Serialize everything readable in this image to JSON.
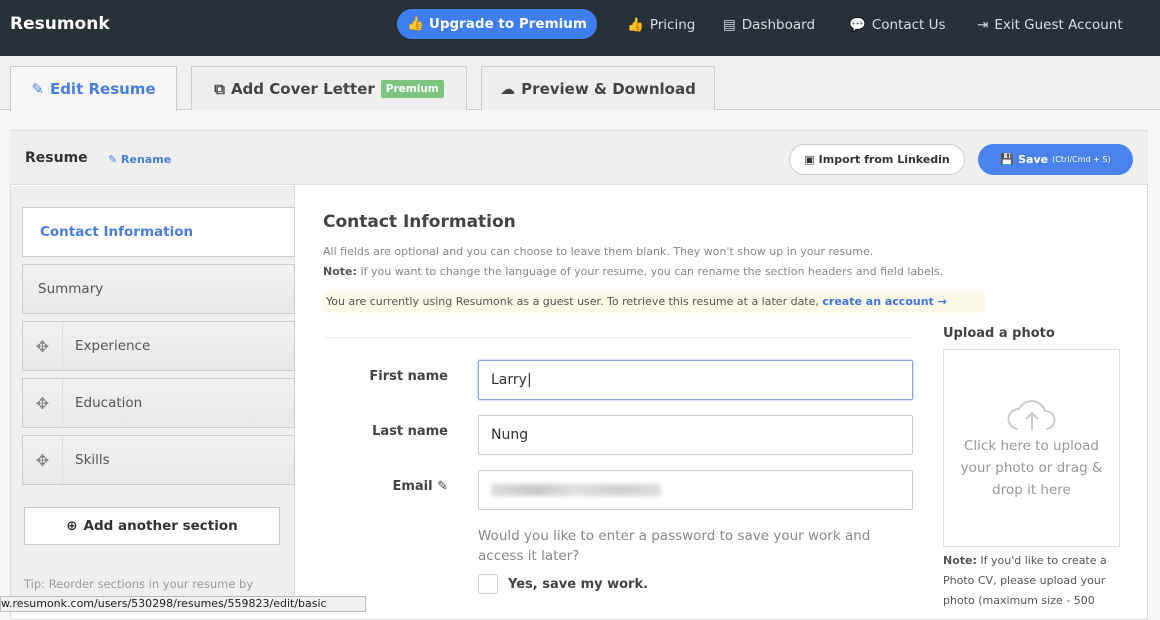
{
  "nav": {
    "brand": "Resumonk",
    "upgrade": "Upgrade to Premium",
    "links": [
      "Pricing",
      "Dashboard",
      "Contact Us",
      "Exit Guest Account"
    ]
  },
  "tabs": [
    {
      "label": "Edit Resume",
      "active": true
    },
    {
      "label": "Add Cover Letter",
      "badge": "Premium"
    },
    {
      "label": "Preview & Download"
    }
  ],
  "header": {
    "title": "Resume",
    "rename": "Rename",
    "import": "Import from Linkedin",
    "save": "Save",
    "save_hint": "(Ctrl/Cmd + S)"
  },
  "sidebar": {
    "items": [
      {
        "label": "Contact Information",
        "active": true
      },
      {
        "label": "Summary"
      },
      {
        "label": "Experience",
        "draggable": true
      },
      {
        "label": "Education",
        "draggable": true
      },
      {
        "label": "Skills",
        "draggable": true
      }
    ],
    "add": "Add another section",
    "tip": "Tip: Reorder sections in your resume by"
  },
  "main": {
    "title": "Contact Information",
    "desc": "All fields are optional and you can choose to leave them blank. They won't show up in your resume.",
    "note_label": "Note:",
    "note": "If you want to change the language of your resume, you can rename the section headers and field labels.",
    "guest": "You are currently using Resumonk as a guest user. To retrieve this resume at a later date,",
    "guest_link": "create an account →",
    "fields": [
      {
        "label": "First name",
        "value": "Larry"
      },
      {
        "label": "Last name",
        "value": "Nung"
      },
      {
        "label": "Email",
        "value": ""
      }
    ],
    "password_q": "Would you like to enter a password to save your work and access it later?",
    "save_work": "Yes, save my work."
  },
  "photo": {
    "title": "Upload a photo",
    "hint": "Click here to upload your photo or drag & drop it here",
    "note_label": "Note:",
    "note": "If you'd like to create a Photo CV, please upload your photo (maximum size - 500"
  },
  "status_url": "w.resumonk.com/users/530298/resumes/559823/edit/basic",
  "colors": {
    "nav": "#263238",
    "accent": "#4a7de0",
    "premium": "#7dc57f"
  }
}
